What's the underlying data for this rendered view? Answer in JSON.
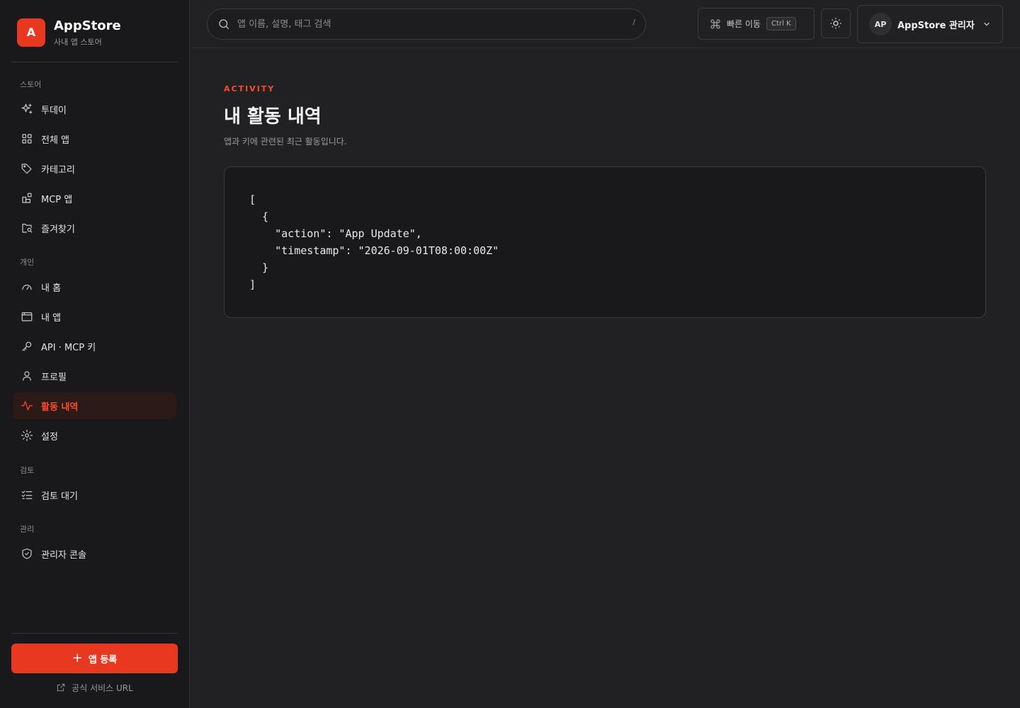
{
  "brand": {
    "logo_letter": "A",
    "name": "AppStore",
    "subtitle": "사내 앱 스토어"
  },
  "sidebar": {
    "sections": [
      {
        "label": "스토어",
        "items": [
          {
            "label": "투데이",
            "icon": "sparkles-icon"
          },
          {
            "label": "전체 앱",
            "icon": "grid-icon"
          },
          {
            "label": "카테고리",
            "icon": "tag-icon"
          },
          {
            "label": "MCP 앱",
            "icon": "blocks-icon"
          },
          {
            "label": "즐겨찾기",
            "icon": "folder-search-icon"
          }
        ]
      },
      {
        "label": "개인",
        "items": [
          {
            "label": "내 홈",
            "icon": "gauge-icon"
          },
          {
            "label": "내 앱",
            "icon": "window-icon"
          },
          {
            "label": "API · MCP 키",
            "icon": "key-icon"
          },
          {
            "label": "프로필",
            "icon": "user-icon"
          },
          {
            "label": "활동 내역",
            "icon": "activity-icon",
            "active": true
          },
          {
            "label": "설정",
            "icon": "gear-icon"
          }
        ]
      },
      {
        "label": "검토",
        "items": [
          {
            "label": "검토 대기",
            "icon": "list-checks-icon"
          }
        ]
      },
      {
        "label": "관리",
        "items": [
          {
            "label": "관리자 콘솔",
            "icon": "shield-icon"
          }
        ]
      }
    ],
    "register_button": "앱 등록",
    "official_link": "공식 서비스 URL"
  },
  "header": {
    "search_placeholder": "앱 이름, 설명, 태그 검색",
    "search_shortcut": "/",
    "quick_nav_label": "빠른 이동",
    "quick_nav_kbd": "Ctrl K",
    "user_initials": "AP",
    "user_name": "AppStore 관리자"
  },
  "main": {
    "eyebrow": "ACTIVITY",
    "title": "내 활동 내역",
    "subtitle": "앱과 키에 관련된 최근 활동입니다.",
    "activity_json": "[\n  {\n    \"action\": \"App Update\",\n    \"timestamp\": \"2026-09-01T08:00:00Z\"\n  }\n]"
  },
  "colors": {
    "accent": "#e8381f",
    "background": "#212124",
    "sidebar": "#19191b"
  }
}
